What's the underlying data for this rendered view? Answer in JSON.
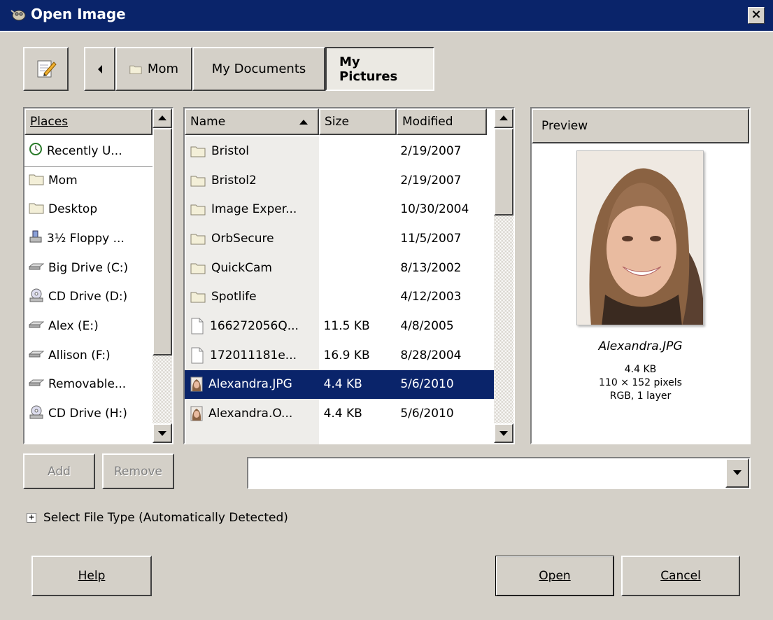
{
  "window": {
    "title": "Open Image",
    "close_label": "×"
  },
  "toolbar": {
    "path_buttons": [
      "Mom",
      "My Documents",
      "My Pictures"
    ],
    "active_path": "My Pictures"
  },
  "places": {
    "header": "Places",
    "items": [
      {
        "label": "Recently U...",
        "icon": "clock-icon"
      },
      {
        "label": "Mom",
        "icon": "folder-icon"
      },
      {
        "label": "Desktop",
        "icon": "folder-icon"
      },
      {
        "label": "3½ Floppy ...",
        "icon": "floppy-icon"
      },
      {
        "label": "Big Drive (C:)",
        "icon": "drive-icon"
      },
      {
        "label": "CD Drive (D:)",
        "icon": "cd-icon"
      },
      {
        "label": "Alex (E:)",
        "icon": "drive-icon"
      },
      {
        "label": "Allison (F:)",
        "icon": "drive-icon"
      },
      {
        "label": "Removable...",
        "icon": "drive-icon"
      },
      {
        "label": "CD Drive (H:)",
        "icon": "cd-icon"
      }
    ]
  },
  "files": {
    "columns": {
      "name": "Name",
      "size": "Size",
      "modified": "Modified"
    },
    "rows": [
      {
        "name": "Bristol",
        "size": "",
        "modified": "2/19/2007",
        "icon": "folder-icon"
      },
      {
        "name": "Bristol2",
        "size": "",
        "modified": "2/19/2007",
        "icon": "folder-icon"
      },
      {
        "name": "Image Exper...",
        "size": "",
        "modified": "10/30/2004",
        "icon": "folder-icon"
      },
      {
        "name": "OrbSecure",
        "size": "",
        "modified": "11/5/2007",
        "icon": "folder-icon"
      },
      {
        "name": "QuickCam",
        "size": "",
        "modified": "8/13/2002",
        "icon": "folder-icon"
      },
      {
        "name": "Spotlife",
        "size": "",
        "modified": "4/12/2003",
        "icon": "folder-icon"
      },
      {
        "name": "166272056Q...",
        "size": "11.5 KB",
        "modified": "4/8/2005",
        "icon": "file-icon"
      },
      {
        "name": "172011181e...",
        "size": "16.9 KB",
        "modified": "8/28/2004",
        "icon": "file-icon"
      },
      {
        "name": "Alexandra.JPG",
        "size": "4.4 KB",
        "modified": "5/6/2010",
        "icon": "image-icon",
        "selected": true
      },
      {
        "name": "Alexandra.O...",
        "size": "4.4 KB",
        "modified": "5/6/2010",
        "icon": "image-icon"
      }
    ]
  },
  "preview": {
    "header": "Preview",
    "filename": "Alexandra.JPG",
    "size": "4.4 KB",
    "dimensions": "110 × 152 pixels",
    "mode": "RGB, 1 layer"
  },
  "buttons": {
    "add": "Add",
    "remove": "Remove",
    "help": "Help",
    "open": "Open",
    "cancel": "Cancel"
  },
  "filetype": {
    "label": "Select File Type (Automatically Detected)"
  }
}
